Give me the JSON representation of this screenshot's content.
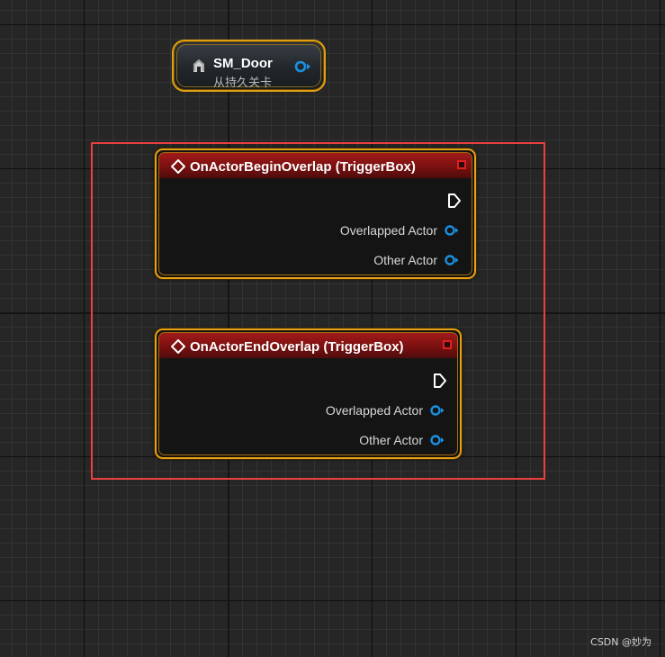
{
  "actor_reference": {
    "name": "SM_Door",
    "subtitle": "从持久关卡",
    "icon": "actor-reference-icon",
    "pin_color": "#1a90e0"
  },
  "selection_box": {
    "color": "#ea4040"
  },
  "nodes": [
    {
      "title": "OnActorBeginOverlap (TriggerBox)",
      "icon": "event-diamond-icon",
      "header_color": "#a11a1a",
      "pins": [
        {
          "type": "exec",
          "label": ""
        },
        {
          "type": "object",
          "label": "Overlapped Actor"
        },
        {
          "type": "object",
          "label": "Other Actor"
        }
      ]
    },
    {
      "title": "OnActorEndOverlap (TriggerBox)",
      "icon": "event-diamond-icon",
      "header_color": "#a11a1a",
      "pins": [
        {
          "type": "exec",
          "label": ""
        },
        {
          "type": "object",
          "label": "Overlapped Actor"
        },
        {
          "type": "object",
          "label": "Other Actor"
        }
      ]
    }
  ],
  "watermark": "CSDN @妙为"
}
